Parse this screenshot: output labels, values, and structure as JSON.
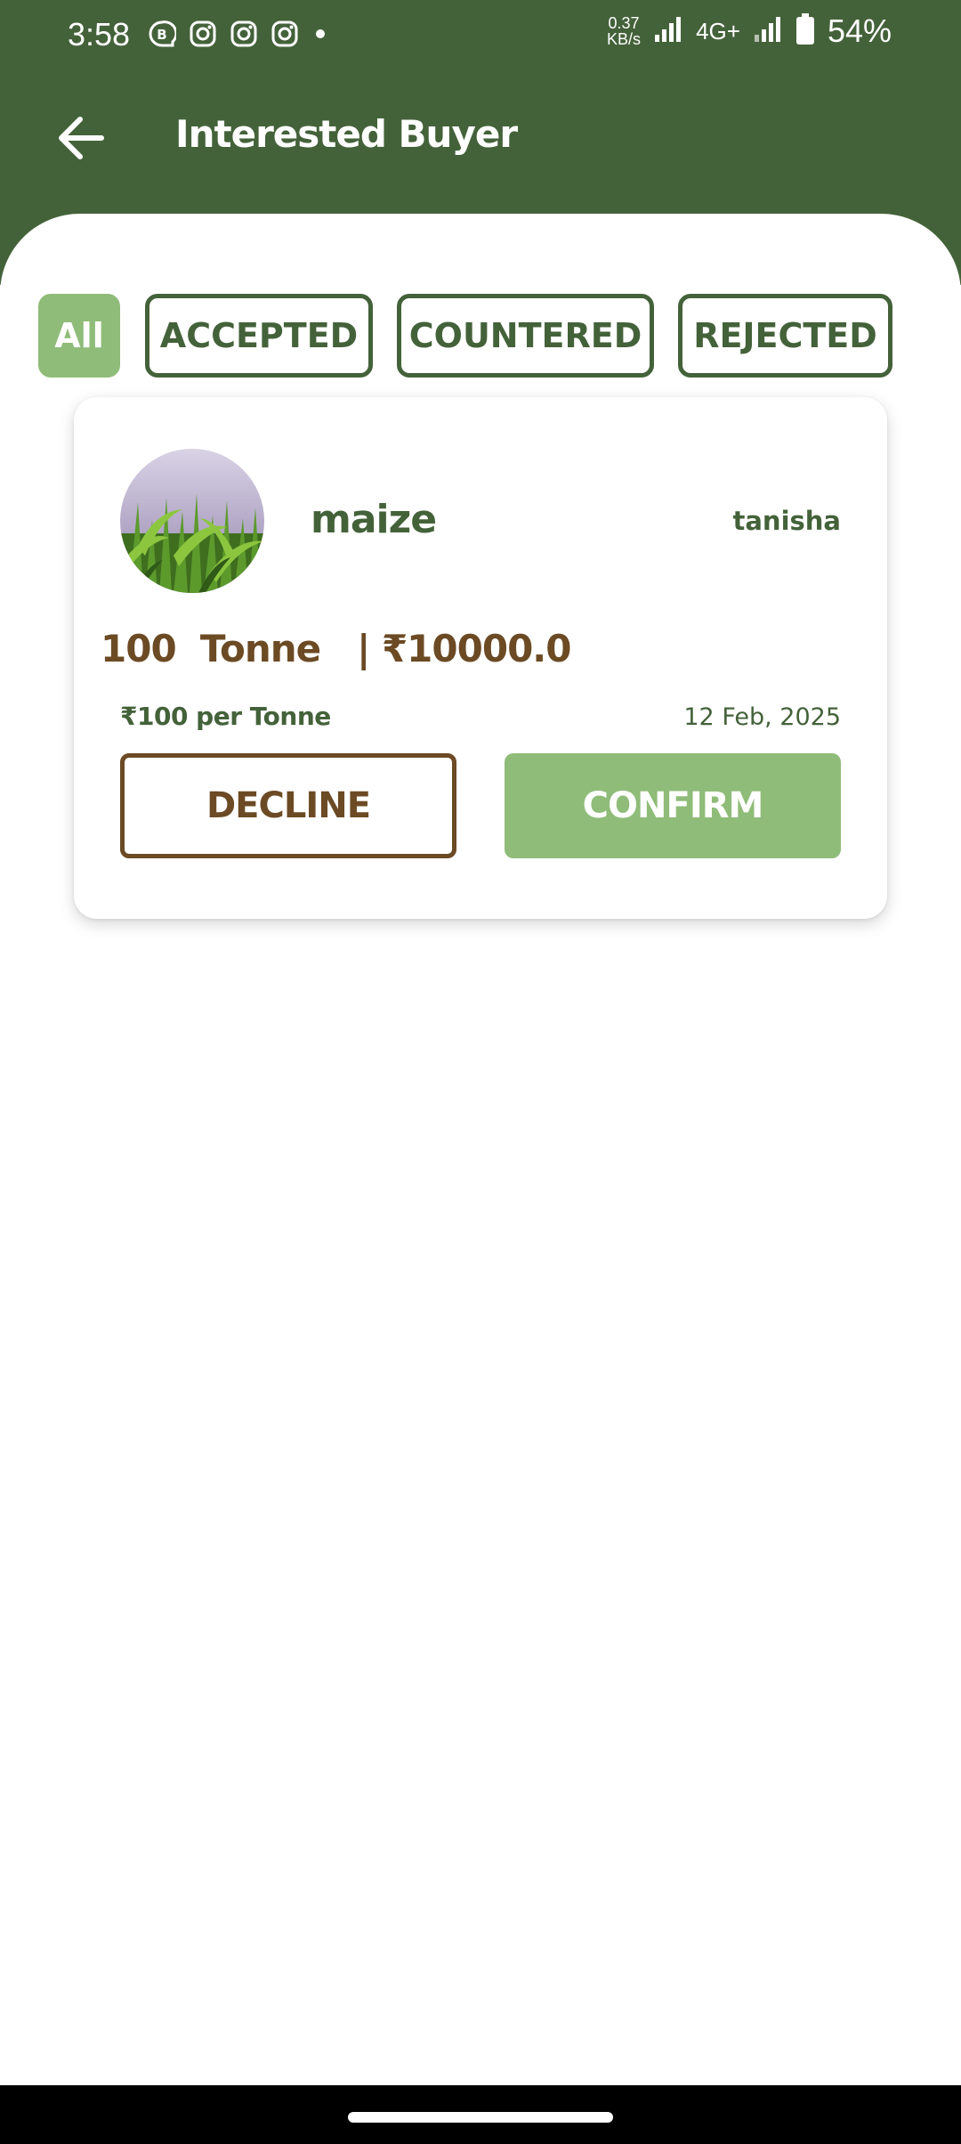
{
  "status_bar": {
    "time": "3:58",
    "net_speed_value": "0.37",
    "net_speed_unit": "KB/s",
    "network_type": "4G+",
    "battery_percent": "54%",
    "icons": [
      "bbm-icon",
      "instagram-icon",
      "instagram-icon",
      "instagram-icon",
      "dot-icon",
      "signal-icon",
      "signal-icon",
      "battery-icon"
    ]
  },
  "header": {
    "title": "Interested Buyer",
    "back_icon": "arrow-left-icon"
  },
  "tabs": [
    {
      "label": "All",
      "active": true
    },
    {
      "label": "ACCEPTED",
      "active": false
    },
    {
      "label": "COUNTERED",
      "active": false
    },
    {
      "label": "REJECTED",
      "active": false
    }
  ],
  "offer_card": {
    "crop_name": "maize",
    "buyer_name": "tanisha",
    "quantity_line": "100  Tonne   | ₹10000.0",
    "rate": "₹100 per Tonne",
    "date": "12 Feb, 2025",
    "decline_label": "DECLINE",
    "confirm_label": "CONFIRM"
  },
  "colors": {
    "primary_green": "#44623a",
    "light_green": "#8fbc79",
    "brown": "#6b4a24",
    "white": "#ffffff"
  }
}
